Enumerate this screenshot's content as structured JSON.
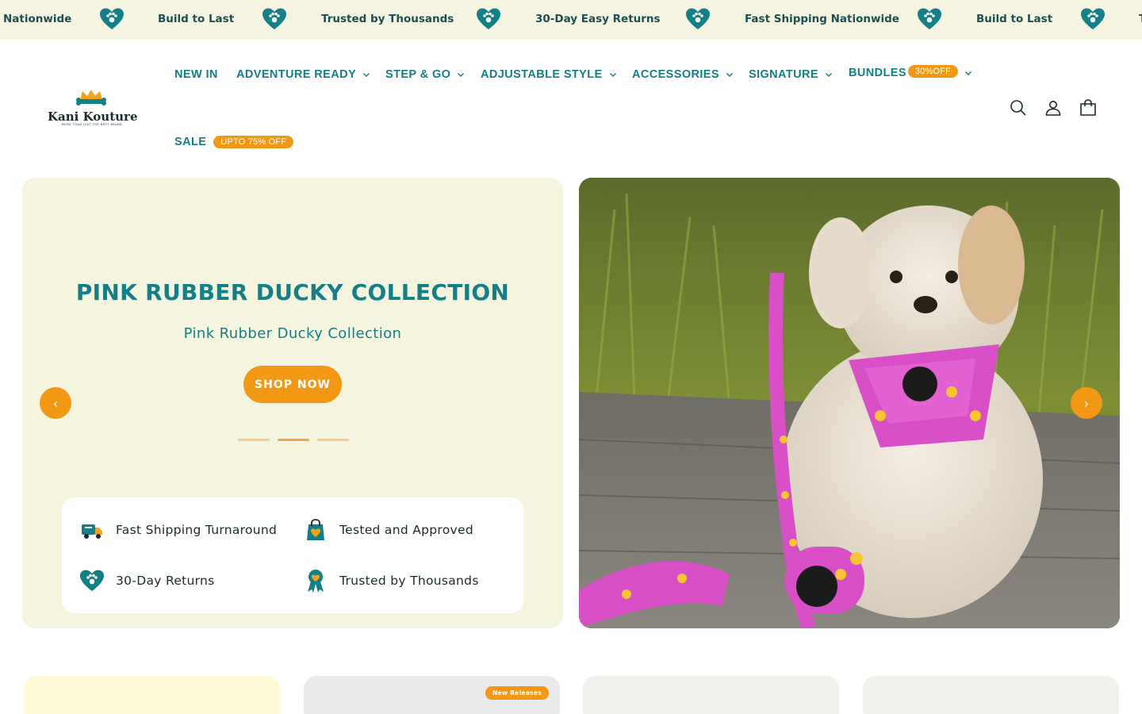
{
  "announcement": {
    "items": [
      "Nationwide",
      "Build to Last",
      "Trusted by Thousands",
      "30-Day Easy Returns",
      "Fast Shipping Nationwide",
      "Build to Last",
      "T"
    ]
  },
  "brand": {
    "name": "Kani Kouture",
    "tagline": "MORE THAN JUST THE BEST BRAND"
  },
  "nav": {
    "new_in": "NEW IN",
    "adventure_ready": "ADVENTURE READY",
    "step_go": "STEP & GO",
    "adjustable_style": "ADJUSTABLE STYLE",
    "accessories": "ACCESSORIES",
    "signature": "SIGNATURE",
    "bundles": "BUNDLES",
    "bundles_badge": "30%OFF",
    "sale": "SALE",
    "sale_badge": "UPTO 75% OFF"
  },
  "hero": {
    "title": "PINK RUBBER DUCKY COLLECTION",
    "subtitle": "Pink Rubber Ducky Collection",
    "cta": "SHOP NOW",
    "prev": "‹",
    "next": "›",
    "slide_count": 3,
    "active_slide": 2,
    "features": [
      "Fast Shipping Turnaround",
      "Tested and Approved",
      "30-Day Returns",
      "Trusted by Thousands"
    ]
  },
  "products": {
    "badge": "New Releases"
  },
  "colors": {
    "teal": "#137f86",
    "orange": "#f39814",
    "cream": "#f5f4de"
  }
}
